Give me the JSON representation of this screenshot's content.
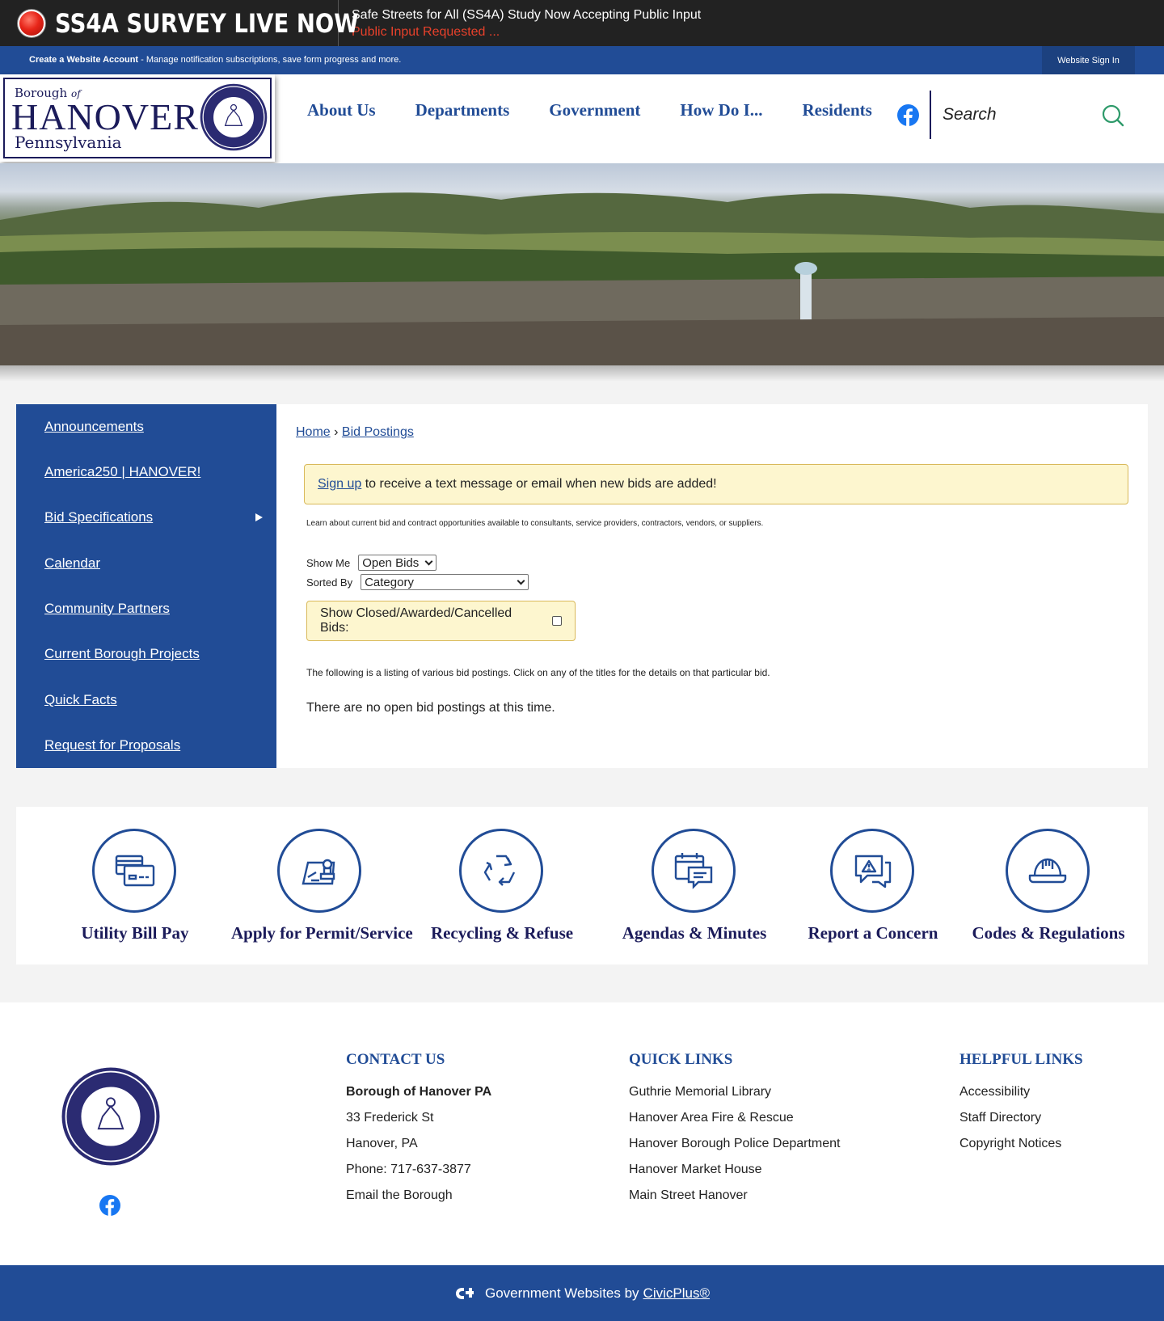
{
  "alert": {
    "title": "SS4A SURVEY LIVE NOW",
    "line1": "Safe Streets for All (SS4A) Study Now Accepting Public Input",
    "line2": "Public Input Requested ..."
  },
  "account_bar": {
    "create_label": "Create a Website Account",
    "create_desc": " - Manage notification subscriptions, save form progress and more.",
    "signin_label": "Website Sign In"
  },
  "logo": {
    "line1": "Borough",
    "line1_small": "of",
    "line2": "HANOVER",
    "line3": "Pennsylvania"
  },
  "nav": {
    "items": [
      "About Us",
      "Departments",
      "Government",
      "How Do I...",
      "Residents"
    ]
  },
  "search": {
    "placeholder": "Search"
  },
  "breadcrumb": {
    "home": "Home",
    "sep": " › ",
    "current": "Bid Postings"
  },
  "sidebar": {
    "items": [
      "Announcements",
      "America250 | HANOVER!",
      "Bid Specifications",
      "Calendar",
      "Community Partners",
      "Current Borough Projects",
      "Quick Facts",
      "Request for Proposals"
    ]
  },
  "main": {
    "signup_link": "Sign up",
    "signup_text": " to receive a text message or email when new bids are added!",
    "learn_text": "Learn about current bid and contract opportunities available to consultants, service providers, contractors, vendors, or suppliers.",
    "show_me_label": "Show Me",
    "show_me_value": "Open Bids",
    "sorted_by_label": "Sorted By",
    "sorted_by_value": "Category",
    "closed_label": "Show Closed/Awarded/Cancelled Bids:",
    "listing_text": "The following is a listing of various bid postings. Click on any of the titles for the details on that particular bid.",
    "none_text": "There are no open bid postings at this time."
  },
  "tiles": [
    "Utility Bill Pay",
    "Apply for Permit/Service",
    "Recycling & Refuse",
    "Agendas & Minutes",
    "Report a Concern",
    "Codes & Regulations"
  ],
  "footer": {
    "contact": {
      "heading": "CONTACT US",
      "name": "Borough of Hanover PA",
      "street": "33 Frederick St",
      "city": "Hanover, PA",
      "phone": "Phone: 717-637-3877",
      "email": "Email the Borough"
    },
    "quick": {
      "heading": "QUICK LINKS",
      "items": [
        "Guthrie Memorial Library",
        "Hanover Area Fire & Rescue",
        "Hanover Borough Police Department",
        "Hanover Market House",
        "Main Street Hanover"
      ]
    },
    "helpful": {
      "heading": "HELPFUL LINKS",
      "items": [
        "Accessibility",
        "Staff Directory",
        "Copyright Notices"
      ]
    }
  },
  "bottom": {
    "text": "Government Websites by",
    "link": "CivicPlus®"
  },
  "colors": {
    "brand_blue": "#214c96",
    "navy": "#1b1b5a",
    "alert_red": "#e8412b",
    "notice_yellow": "#fdf6cf"
  }
}
